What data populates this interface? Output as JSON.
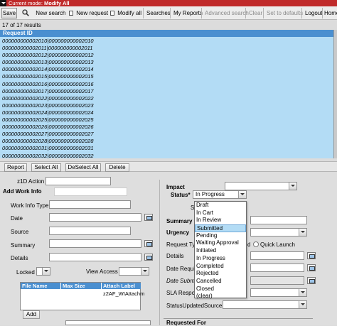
{
  "mode_bar": {
    "label": "Current mode:",
    "value": "Modify All"
  },
  "toolbar": {
    "save": "Save",
    "new_search": "New search",
    "new_request": "New request",
    "modify_all": "Modify all",
    "searches": "Searches",
    "my_reports": "My Reports",
    "advanced_search": "Advanced search",
    "clear": "Clear",
    "set_to_defaults": "Set to defaults",
    "logout": "Logout",
    "home": "Home"
  },
  "results": {
    "count_text": "17 of 17 results",
    "column_header": "Request ID",
    "rows": [
      "000000000002010|000000000002010",
      "000000000002011|000000000002011",
      "000000000002012|000000000002012",
      "000000000002013|000000000002013",
      "000000000002014|000000000002014",
      "000000000002015|000000000002015",
      "000000000002016|000000000002016",
      "000000000002017|000000000002017",
      "000000000002022|000000000002022",
      "000000000002023|000000000002023",
      "000000000002024|000000000002024",
      "000000000002025|000000000002025",
      "000000000002026|000000000002026",
      "000000000002027|000000000002027",
      "000000000002028|000000000002028",
      "000000000002031|000000000002031",
      "000000000002032|000000000002032"
    ]
  },
  "table_buttons": {
    "report": "Report",
    "select_all": "Select All",
    "deselect_all": "DeSelect All",
    "delete": "Delete"
  },
  "form": {
    "z1d_action": "z1D Action",
    "add_work_info": "Add Work Info",
    "work_info_type": "Work Info Type",
    "date": "Date",
    "source": "Source",
    "summary_left": "Summary",
    "details_left": "Details",
    "locked": "Locked",
    "view_access": "View Access",
    "attach_headers": [
      "File Name",
      "Max Size",
      "Attach Label"
    ],
    "attach_cell": "z2AF_WIAttachm",
    "add_button": "Add",
    "impact": "Impact",
    "status": "Status*",
    "status_value": "In Progress",
    "summary_right": "Summary",
    "urgency": "Urgency",
    "request_type": "Request Typ",
    "request_type_tail": "d",
    "quick_launch": "Quick Launch",
    "details_right": "Details",
    "date_required": "Date Requi",
    "date_submitted": "Date Submi",
    "sla_responded": "SLA Respon",
    "status_updated_source": "StatusUpdatedSource",
    "requested_for": "Requested For"
  },
  "status_options": [
    "Draft",
    "In Cart",
    "In Review",
    "Submitted",
    "Pending",
    "Waiting Approval",
    "Initiated",
    "In Progress",
    "Completed",
    "Rejected",
    "Cancelled",
    "Closed",
    "(clear)"
  ],
  "status_highlighted": "Submitted",
  "colors": {
    "mode_bar": "#c02a2a",
    "results_bg": "#b3dcf5",
    "header_blue": "#4a8fd0"
  }
}
